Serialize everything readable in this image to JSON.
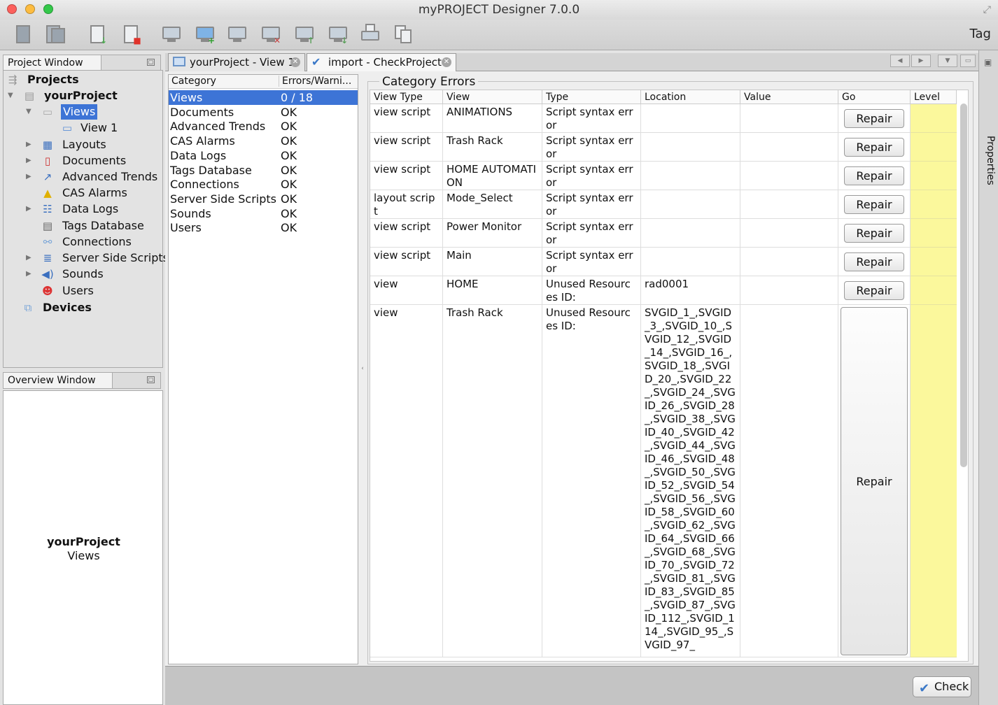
{
  "window": {
    "title": "myPROJECT Designer 7.0.0"
  },
  "toolbar": {
    "right_label": "Tag"
  },
  "project_window": {
    "tab_label": "Project Window"
  },
  "tree": {
    "root": "Projects",
    "project": "yourProject",
    "views": "Views",
    "view1": "View 1",
    "layouts": "Layouts",
    "documents": "Documents",
    "trends": "Advanced Trends",
    "alarms": "CAS Alarms",
    "datalogs": "Data Logs",
    "tags": "Tags Database",
    "connections": "Connections",
    "scripts": "Server Side Scripts",
    "sounds": "Sounds",
    "users": "Users",
    "devices": "Devices"
  },
  "overview_window": {
    "tab_label": "Overview Window",
    "project": "yourProject",
    "subtitle": "Views"
  },
  "tabs": [
    {
      "label": "yourProject - View 1"
    },
    {
      "label": "import - CheckProject"
    }
  ],
  "properties_label": "Properties",
  "category_panel": {
    "headers": [
      "Category",
      "Errors/Warni..."
    ],
    "rows": [
      {
        "category": "Views",
        "status": "0 / 18"
      },
      {
        "category": "Documents",
        "status": "OK"
      },
      {
        "category": "Advanced Trends",
        "status": "OK"
      },
      {
        "category": "CAS Alarms",
        "status": "OK"
      },
      {
        "category": "Data Logs",
        "status": "OK"
      },
      {
        "category": "Tags Database",
        "status": "OK"
      },
      {
        "category": "Connections",
        "status": "OK"
      },
      {
        "category": "Server Side Scripts",
        "status": "OK"
      },
      {
        "category": "Sounds",
        "status": "OK"
      },
      {
        "category": "Users",
        "status": "OK"
      }
    ]
  },
  "category_errors": {
    "title": "Category Errors",
    "headers": [
      "View Type",
      "View",
      "Type",
      "Location",
      "Value",
      "Go",
      "Level"
    ],
    "repair_label": "Repair",
    "rows": [
      {
        "view_type": "view script",
        "view": "ANIMATIONS",
        "type": "Script syntax error",
        "location": "",
        "value": ""
      },
      {
        "view_type": "view script",
        "view": "Trash Rack",
        "type": "Script syntax error",
        "location": "",
        "value": ""
      },
      {
        "view_type": "view script",
        "view": "HOME AUTOMATION",
        "type": "Script syntax error",
        "location": "",
        "value": ""
      },
      {
        "view_type": "layout script",
        "view": "Mode_Select",
        "type": "Script syntax error",
        "location": "",
        "value": ""
      },
      {
        "view_type": "view script",
        "view": "Power Monitor",
        "type": "Script syntax error",
        "location": "",
        "value": ""
      },
      {
        "view_type": "view script",
        "view": "Main",
        "type": "Script syntax error",
        "location": "",
        "value": ""
      },
      {
        "view_type": "view",
        "view": "HOME",
        "type": "Unused Resources ID:",
        "location": "rad0001",
        "value": ""
      },
      {
        "view_type": "view",
        "view": "Trash Rack",
        "type": "Unused Resources ID:",
        "location": "SVGID_1_,SVGID_3_,SVGID_10_,SVGID_12_,SVGID_14_,SVGID_16_,SVGID_18_,SVGID_20_,SVGID_22_,SVGID_24_,SVGID_26_,SVGID_28_,SVGID_38_,SVGID_40_,SVGID_42_,SVGID_44_,SVGID_46_,SVGID_48_,SVGID_50_,SVGID_52_,SVGID_54_,SVGID_56_,SVGID_58_,SVGID_60_,SVGID_62_,SVGID_64_,SVGID_66_,SVGID_68_,SVGID_70_,SVGID_72_,SVGID_81_,SVGID_83_,SVGID_85_,SVGID_87_,SVGID_112_,SVGID_114_,SVGID_95_,SVGID_97_",
        "value": ""
      }
    ]
  },
  "bottom": {
    "check_label": "Check"
  }
}
